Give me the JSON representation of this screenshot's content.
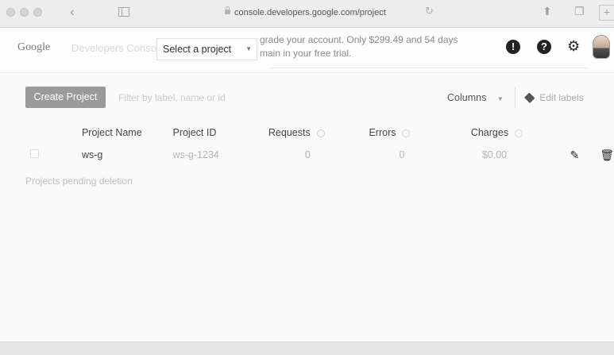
{
  "browser": {
    "url": "console.developers.google.com/project",
    "icons": [
      "close-dot",
      "minimize-dot",
      "zoom-dot",
      "back-icon",
      "sidebar-icon",
      "lock-icon",
      "reload-icon",
      "share-icon",
      "tabs-icon",
      "new-tab-icon"
    ]
  },
  "header": {
    "logo": "Google",
    "logo_sub": "Developers Console",
    "project_select": "Select a project",
    "banner_line1": "grade your account. Only $299.49 and 54 days",
    "banner_line2": "main in your free trial.",
    "notification_symbol": "!",
    "help_symbol": "?",
    "icons": [
      "notification-icon",
      "help-icon",
      "settings-icon",
      "avatar"
    ]
  },
  "toolbar": {
    "create_label": "Create Project",
    "filter_placeholder": "Filter by label, name or id",
    "columns_label": "Columns",
    "edit_labels": "Edit labels"
  },
  "table": {
    "headers": {
      "name": "Project Name",
      "id": "Project ID",
      "requests": "Requests",
      "errors": "Errors",
      "charges": "Charges"
    },
    "rows": [
      {
        "name": "ws-g",
        "id": "ws-g-1234",
        "requests": "0",
        "errors": "0",
        "charges": "$0.00"
      }
    ]
  },
  "pending_label": "Projects pending deletion",
  "colors": {
    "create_button": "#9a9a9a",
    "background": "#fafafa"
  }
}
